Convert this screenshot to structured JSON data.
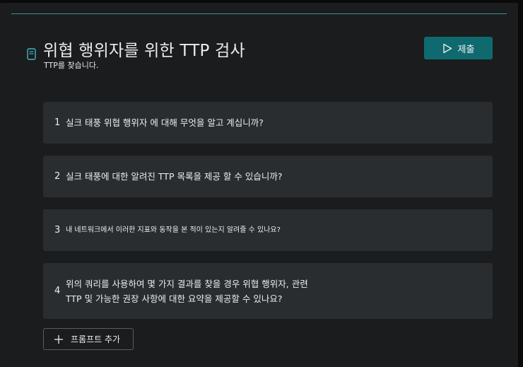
{
  "header": {
    "title": "위협 행위자를 위한 TTP 검사",
    "subtitle": "TTP를 찾습니다.",
    "submit_label": "제출"
  },
  "prompts": [
    {
      "number": "1",
      "text": "실크 태풍 위협 행위자 에 대해 무엇을 알고 계십니까?"
    },
    {
      "number": "2",
      "text": "실크 태풍에 대한 알려진 TTP 목록을 제공 할 수 있습니까?"
    },
    {
      "number": "3",
      "text": "내 네트워크에서 이러한 지표와 동작을 본 적이 있는지 알려줄 수 있나요?"
    },
    {
      "number": "4",
      "text_line1": "위의 쿼리를 사용하여 몇 가지 결과를 찾을 경우 위협 행위자, 관련",
      "text_line2": "TTP 및 가능한 권장 사항에 대한 요약을 제공할 수 있나요?"
    }
  ],
  "add_prompt_label": "프롬프트 추가",
  "icons": {
    "document": "document-icon",
    "submit": "play-icon",
    "add": "plus-icon"
  },
  "colors": {
    "accent": "#0f6a70",
    "rule": "#3b8e97",
    "card": "#2a2d30",
    "panel": "#1b1c1e"
  }
}
